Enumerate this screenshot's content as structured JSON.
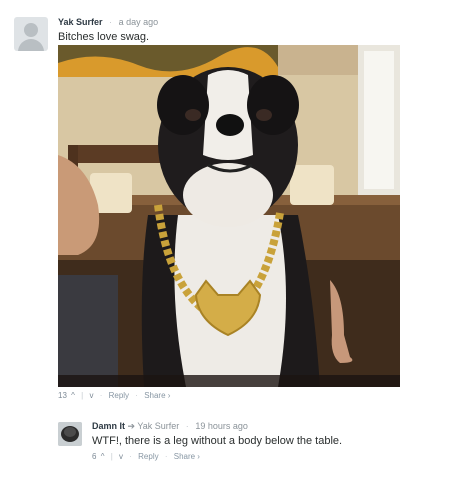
{
  "comment1": {
    "author": "Yak Surfer",
    "time": "a day ago",
    "text": "Bitches love swag.",
    "votes": "13",
    "upvote_icon": "^",
    "downvote_icon": "v",
    "reply_label": "Reply",
    "share_label": "Share ›"
  },
  "comment2": {
    "author": "Damn It",
    "reply_to_arrow": "➔",
    "reply_to": "Yak Surfer",
    "time": "19 hours ago",
    "text": "WTF!, there is a leg without a body below the table.",
    "votes": "6",
    "upvote_icon": "^",
    "downvote_icon": "v",
    "reply_label": "Reply",
    "share_label": "Share ›"
  },
  "separator": "·",
  "colors": {
    "author": "#2e3a44",
    "meta": "#8b9399",
    "links": "#8796a3",
    "background": "#ffffff"
  }
}
